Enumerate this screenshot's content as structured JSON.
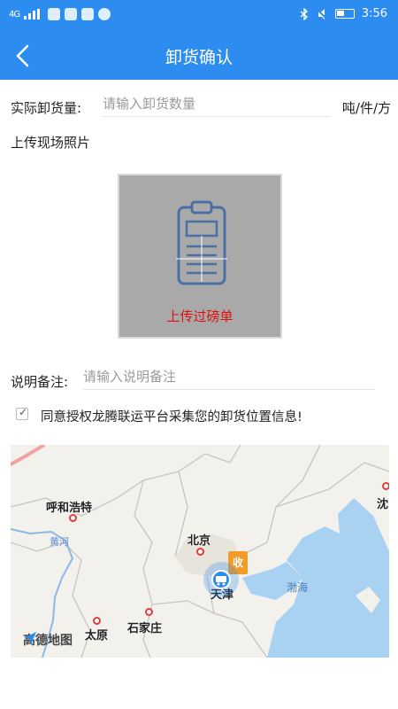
{
  "status_bar": {
    "signal": "4G",
    "time": "3:56"
  },
  "nav": {
    "title": "卸货确认"
  },
  "form": {
    "unload_label": "实际卸货量:",
    "unload_placeholder": "请输入卸货数量",
    "unit_label": "吨/件/方",
    "photo_title": "上传现场照片",
    "upload_label": "上传过磅单",
    "remark_label": "说明备注:",
    "remark_placeholder": "请输入说明备注",
    "agree_text": "同意授权龙腾联运平台采集您的卸货位置信息!",
    "agree_checked": true
  },
  "map": {
    "cities": [
      "呼和浩特",
      "北京",
      "天津",
      "太原",
      "石家庄",
      "沈"
    ],
    "river": "黄河",
    "sea": "渤海",
    "receive_badge": "收",
    "logo_text": "高德地图"
  },
  "colors": {
    "primary": "#2c8cf0",
    "upload_text": "#e01010",
    "badge": "#f09b2a"
  }
}
